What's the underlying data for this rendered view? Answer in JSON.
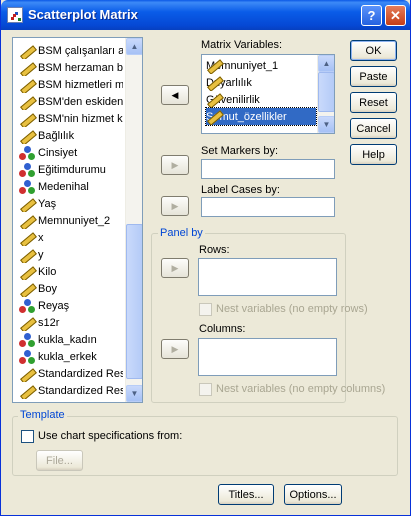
{
  "window": {
    "title": "Scatterplot Matrix",
    "help_label": "?",
    "close_label": "✕"
  },
  "variables": [
    {
      "name": "BSM çalışanları asl",
      "type": "scale"
    },
    {
      "name": "BSM herzaman be",
      "type": "scale"
    },
    {
      "name": "BSM hizmetleri mül",
      "type": "scale"
    },
    {
      "name": "BSM'den eskiden l",
      "type": "scale"
    },
    {
      "name": "BSM'nin hizmet ka",
      "type": "scale"
    },
    {
      "name": "Bağlılık",
      "type": "scale"
    },
    {
      "name": "Cinsiyet",
      "type": "nominal"
    },
    {
      "name": "Eğitimdurumu",
      "type": "nominal"
    },
    {
      "name": "Medenihal",
      "type": "nominal"
    },
    {
      "name": "Yaş",
      "type": "scale"
    },
    {
      "name": "Memnuniyet_2",
      "type": "scale"
    },
    {
      "name": "x",
      "type": "scale"
    },
    {
      "name": "y",
      "type": "scale"
    },
    {
      "name": "Kilo",
      "type": "scale"
    },
    {
      "name": "Boy",
      "type": "scale"
    },
    {
      "name": "Reyaş",
      "type": "nominal"
    },
    {
      "name": "s12r",
      "type": "scale"
    },
    {
      "name": "kukla_kadın",
      "type": "nominal"
    },
    {
      "name": "kukla_erkek",
      "type": "nominal"
    },
    {
      "name": "Standardized Resi",
      "type": "scale"
    },
    {
      "name": "Standardized Resi",
      "type": "scale"
    }
  ],
  "matrix_variables": {
    "label": "Matrix Variables:",
    "items": [
      {
        "name": "Memnuniyet_1",
        "type": "scale",
        "selected": false
      },
      {
        "name": "Duyarlılık",
        "type": "scale",
        "selected": false
      },
      {
        "name": "Güvenilirlik",
        "type": "scale",
        "selected": false
      },
      {
        "name": "Somut_özellikler",
        "type": "scale",
        "selected": true
      }
    ]
  },
  "set_markers": {
    "label": "Set Markers by:",
    "value": ""
  },
  "label_cases": {
    "label": "Label Cases by:",
    "value": ""
  },
  "panel_by": {
    "title": "Panel by",
    "rows_label": "Rows:",
    "rows_nest_label": "Nest variables (no empty rows)",
    "columns_label": "Columns:",
    "columns_nest_label": "Nest variables (no empty columns)"
  },
  "template": {
    "title": "Template",
    "use_chart_label": "Use chart specifications from:",
    "file_button": "File..."
  },
  "buttons": {
    "ok": "OK",
    "paste": "Paste",
    "reset": "Reset",
    "cancel": "Cancel",
    "help": "Help",
    "titles": "Titles...",
    "options": "Options..."
  },
  "icons": {
    "move_left": "◀",
    "move_right": "▶",
    "scroll_up": "▲",
    "scroll_down": "▼"
  }
}
